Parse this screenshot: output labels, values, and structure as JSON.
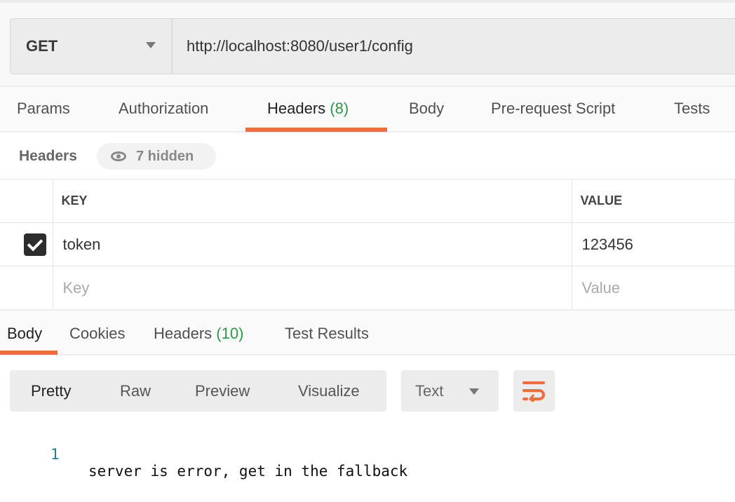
{
  "request": {
    "method": "GET",
    "url": "http://localhost:8080/user1/config"
  },
  "request_tabs": [
    {
      "label": "Params"
    },
    {
      "label": "Authorization"
    },
    {
      "label": "Headers",
      "count": "(8)",
      "active": true
    },
    {
      "label": "Body"
    },
    {
      "label": "Pre-request Script"
    },
    {
      "label": "Tests"
    }
  ],
  "headers_section": {
    "title": "Headers",
    "hidden_label": "7 hidden",
    "hidden_icon": "eye-icon"
  },
  "headers_table": {
    "columns": [
      "KEY",
      "VALUE"
    ],
    "rows": [
      {
        "checked": true,
        "key": "token",
        "value": "123456"
      }
    ],
    "placeholder_key": "Key",
    "placeholder_value": "Value"
  },
  "response_tabs": [
    {
      "label": "Body",
      "active": true
    },
    {
      "label": "Cookies"
    },
    {
      "label": "Headers",
      "count": "(10)"
    },
    {
      "label": "Test Results"
    }
  ],
  "format_buttons": [
    "Pretty",
    "Raw",
    "Preview",
    "Visualize"
  ],
  "format_active": "Pretty",
  "body_type": "Text",
  "wrap_icon": "wrap-lines-icon",
  "response_body": {
    "line_number": "1",
    "text": "server is error, get in the fallback"
  },
  "colors": {
    "accent": "#f26b3a",
    "count": "#2b9a47"
  }
}
